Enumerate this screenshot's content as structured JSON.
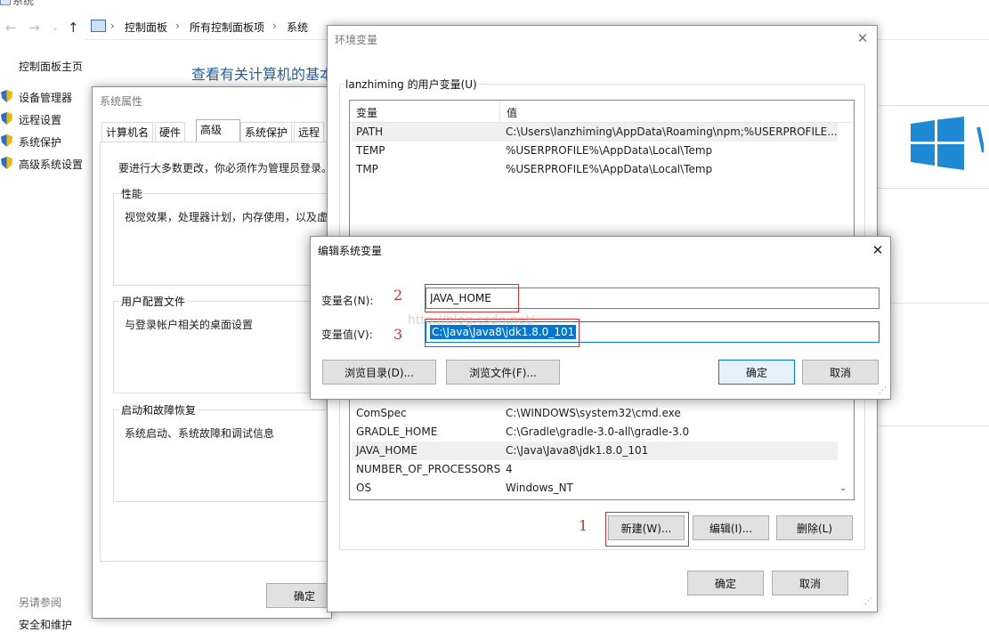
{
  "control_panel": {
    "window_title": "系统",
    "breadcrumbs": [
      "控制面板",
      "所有控制面板项",
      "系统"
    ],
    "sidebar_home": "控制面板主页",
    "sidebar_items": [
      "设备管理器",
      "远程设置",
      "系统保护",
      "高级系统设置"
    ],
    "heading": "查看有关计算机的基本",
    "see_also": "另请参阅",
    "security": "安全和维护"
  },
  "sysprops": {
    "title": "系统属性",
    "tabs": [
      "计算机名",
      "硬件",
      "高级",
      "系统保护",
      "远程"
    ],
    "active_tab": "高级",
    "admin_note": "要进行大多数更改，你必须作为管理员登录。",
    "perf_label": "性能",
    "perf_desc": "视觉效果，处理器计划，内存使用，以及虚",
    "profile_label": "用户配置文件",
    "profile_desc": "与登录帐户相关的桌面设置",
    "startup_label": "启动和故障恢复",
    "startup_desc": "系统启动、系统故障和调试信息",
    "ok": "确定"
  },
  "envvars": {
    "title": "环境变量",
    "user_group": "lanzhiming 的用户变量(U)",
    "col_var": "变量",
    "col_val": "值",
    "user_rows": [
      {
        "name": "PATH",
        "value": "C:\\Users\\lanzhiming\\AppData\\Roaming\\npm;%USERPROFILE..."
      },
      {
        "name": "TEMP",
        "value": "%USERPROFILE%\\AppData\\Local\\Temp"
      },
      {
        "name": "TMP",
        "value": "%USERPROFILE%\\AppData\\Local\\Temp"
      }
    ],
    "sys_rows": [
      {
        "name": "ComSpec",
        "value": "C:\\WINDOWS\\system32\\cmd.exe"
      },
      {
        "name": "GRADLE_HOME",
        "value": "C:\\Gradle\\gradle-3.0-all\\gradle-3.0"
      },
      {
        "name": "JAVA_HOME",
        "value": "C:\\Java\\Java8\\jdk1.8.0_101"
      },
      {
        "name": "NUMBER_OF_PROCESSORS",
        "value": "4"
      },
      {
        "name": "OS",
        "value": "Windows_NT"
      }
    ],
    "new_btn": "新建(W)...",
    "edit_btn": "编辑(I)...",
    "delete_btn": "删除(L)",
    "ok": "确定",
    "cancel": "取消"
  },
  "edit_dialog": {
    "title": "编辑系统变量",
    "name_label": "变量名(N):",
    "value_label": "变量值(V):",
    "name_value": "JAVA_HOME",
    "value_value": "C:\\Java\\Java8\\jdk1.8.0_101",
    "browse_dir": "浏览目录(D)...",
    "browse_file": "浏览文件(F)...",
    "ok": "确定",
    "cancel": "取消"
  },
  "annotations": {
    "n1": "1",
    "n2": "2",
    "n3": "3",
    "color": "#d42b2b"
  }
}
